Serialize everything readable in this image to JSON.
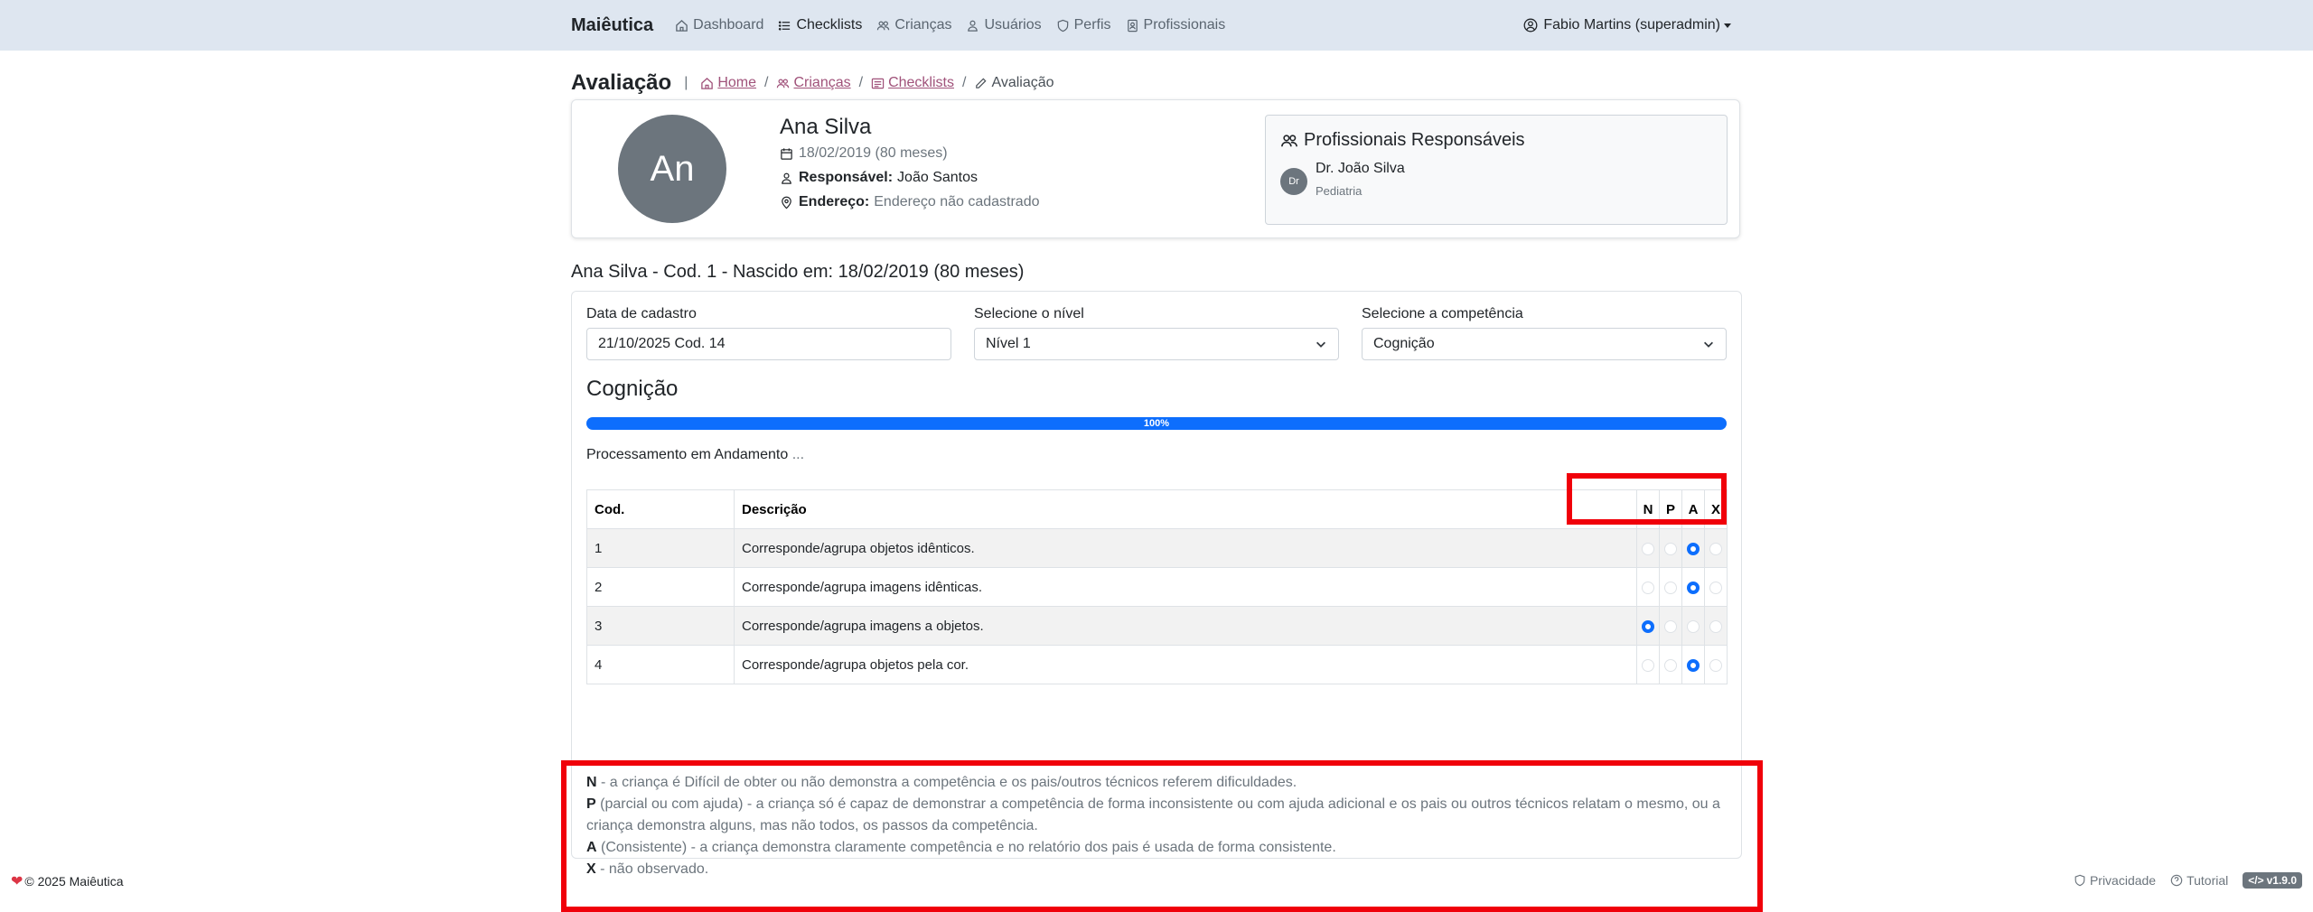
{
  "navbar": {
    "brand": "Maiêutica",
    "items": [
      {
        "label": "Dashboard",
        "icon": "home-icon",
        "active": false
      },
      {
        "label": "Checklists",
        "icon": "list-icon",
        "active": true
      },
      {
        "label": "Crianças",
        "icon": "people-icon",
        "active": false
      },
      {
        "label": "Usuários",
        "icon": "person-icon",
        "active": false
      },
      {
        "label": "Perfis",
        "icon": "shield-icon",
        "active": false
      },
      {
        "label": "Profissionais",
        "icon": "badge-icon",
        "active": false
      }
    ],
    "user": "Fabio Martins (superadmin)"
  },
  "header": {
    "title": "Avaliação",
    "breadcrumb": {
      "home": "Home",
      "children": "Crianças",
      "checklists": "Checklists",
      "current": "Avaliação"
    }
  },
  "profile": {
    "initials": "An",
    "name": "Ana Silva",
    "birth": "18/02/2019 (80 meses)",
    "responsavel_label": "Responsável:",
    "responsavel": "João Santos",
    "endereco_label": "Endereço:",
    "endereco": "Endereço não cadastrado",
    "professionals_title": "Profissionais Responsáveis",
    "professional": {
      "initials": "Dr",
      "name": "Dr. João Silva",
      "specialty": "Pediatria"
    }
  },
  "record_title": "Ana Silva - Cod. 1 - Nascido em: 18/02/2019 (80 meses)",
  "form": {
    "date_label": "Data de cadastro",
    "date_value": "21/10/2025 Cod. 14",
    "level_label": "Selecione o nível",
    "level_value": "Nível 1",
    "competence_label": "Selecione a competência",
    "competence_value": "Cognição"
  },
  "section": {
    "title": "Cognição",
    "progress_percent": 100,
    "progress_label": "100%",
    "processing": "Processamento em Andamento",
    "processing_dots": "..."
  },
  "table": {
    "headers": {
      "cod": "Cod.",
      "desc": "Descrição",
      "n": "N",
      "p": "P",
      "a": "A",
      "x": "X"
    },
    "rows": [
      {
        "cod": "1",
        "desc": "Corresponde/agrupa objetos idênticos.",
        "selected": "A"
      },
      {
        "cod": "2",
        "desc": "Corresponde/agrupa imagens idênticas.",
        "selected": "A"
      },
      {
        "cod": "3",
        "desc": "Corresponde/agrupa imagens a objetos.",
        "selected": "N"
      },
      {
        "cod": "4",
        "desc": "Corresponde/agrupa objetos pela cor.",
        "selected": "A"
      }
    ]
  },
  "legend": {
    "n_key": "N",
    "n_text": " - a criança é Difícil de obter ou não demonstra a competência e os pais/outros técnicos referem dificuldades.",
    "p_key": "P",
    "p_text": " (parcial ou com ajuda) - a criança só é capaz de demonstrar a competência de forma inconsistente ou com ajuda adicional e os pais ou outros técnicos relatam o mesmo, ou a criança demonstra alguns, mas não todos, os passos da competência.",
    "a_key": "A",
    "a_text": " (Consistente) - a criança demonstra claramente competência e no relatório dos pais é usada de forma consistente.",
    "x_key": "X",
    "x_text": " - não observado."
  },
  "footer": {
    "copyright": "© 2025 Maiêutica",
    "privacy": "Privacidade",
    "tutorial": "Tutorial",
    "version": "v1.9.0"
  },
  "colors": {
    "accent": "#0d6efd",
    "link": "#a0527a",
    "highlight": "#f0000a",
    "navbar": "#dee6f0"
  }
}
